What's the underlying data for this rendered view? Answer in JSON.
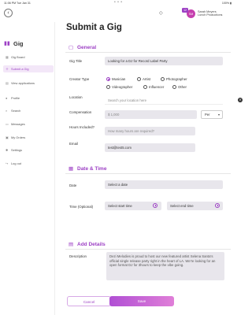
{
  "status_bar": {
    "time": "11:06 PM  Tue Jan 31",
    "dots": "• • •",
    "battery": "100% ▮"
  },
  "header": {
    "back_icon": "‹",
    "tag_icon": "◇",
    "notification_count": "12",
    "avatar_initials": "SM",
    "profile_name_line1": "Sarah Meyers",
    "profile_name_line2": "Lunch Productions"
  },
  "sidebar": {
    "logo_text": "Gig",
    "items": [
      {
        "label": "Gig Board",
        "active": false
      },
      {
        "label": "Submit a Gig",
        "active": true
      },
      {
        "label": "View applications",
        "active": false
      },
      {
        "label": "Profile",
        "active": false
      },
      {
        "label": "Search",
        "active": false
      },
      {
        "label": "Messages",
        "active": false
      },
      {
        "label": "My Orders",
        "active": false
      },
      {
        "label": "Settings",
        "active": false
      },
      {
        "label": "Log out",
        "active": false
      }
    ]
  },
  "page_title": "Submit a Gig",
  "general": {
    "heading": "General",
    "gig_title_label": "Gig Title",
    "gig_title_value": "Looking for a DJ for Record Label Party",
    "creator_type_label": "Creator Type",
    "creator_options": [
      "Musician",
      "Artist",
      "Photographer",
      "Videographer",
      "Influencer",
      "Other"
    ],
    "creator_selected": "Musician",
    "location_label": "Location",
    "location_placeholder": "Search your location here",
    "compensation_label": "Compensation",
    "compensation_value": "$ 1,000",
    "compensation_unit": "Per",
    "hours_label": "Hours Included?",
    "hours_placeholder": "How many hours are required?",
    "email_label": "Email",
    "email_value": "test@test5.com"
  },
  "datetime": {
    "heading": "Date & Time",
    "date_label": "Date",
    "date_placeholder": "Select a date",
    "time_label": "Time (Optional)",
    "start_placeholder": "Select start time",
    "end_placeholder": "Select end time"
  },
  "details": {
    "heading": "Add Details",
    "description_label": "Description",
    "description_value": "Dezi Melodies is proud to host our new featured artist Selena Santa's official single release party right in the heart of LA. We're looking for an open format DJ for 3hours to keep the vibe going."
  },
  "actions": {
    "cancel_label": "Cancel",
    "save_label": "Save"
  },
  "colors": {
    "accent": "#9c3fc4",
    "field_bg": "#e8e6ec",
    "save_gradient_end": "#e07fd8"
  }
}
